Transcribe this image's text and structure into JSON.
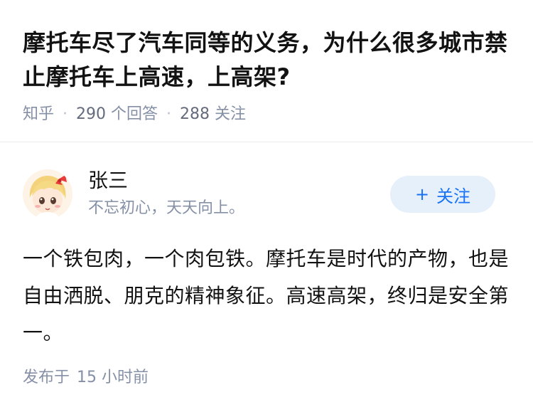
{
  "question": {
    "title": "摩托车尽了汽车同等的义务，为什么很多城市禁止摩托车上高速，上高架?",
    "source": "知乎",
    "separator": "·",
    "answer_count": "290",
    "answer_label": "个回答",
    "follow_count": "288",
    "follow_label": "关注"
  },
  "answer": {
    "author_name": "张三",
    "author_bio": "不忘初心，天天向上。",
    "follow_button": {
      "plus": "+",
      "label": "关注"
    },
    "content": "一个铁包肉，一个肉包铁。摩托车是时代的产物，也是自由洒脱、朋克的精神象征。高速高架，终归是安全第一。",
    "published_label": "发布于",
    "published_value": "15",
    "published_unit": "小时前"
  },
  "colors": {
    "accent": "#1772f6",
    "follow_bg": "#e6f0fb",
    "meta_text": "#8590a6"
  }
}
